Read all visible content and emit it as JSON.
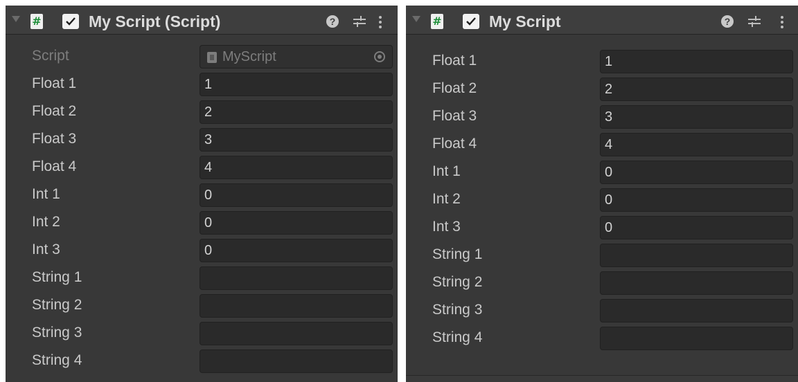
{
  "colors": {
    "panel_bg": "#383838",
    "field_bg": "#2a2a2a",
    "label_text": "#c9c9c9",
    "script_icon_green": "#1f8f3a"
  },
  "left": {
    "header": {
      "title": "My Script (Script)",
      "script_icon_glyph": "#",
      "enabled": true,
      "icons": [
        "help-icon",
        "preset-icon",
        "more-options-icon"
      ]
    },
    "script_row": {
      "label": "Script",
      "value": "MyScript"
    },
    "fields": [
      {
        "label": "Float 1",
        "value": "1"
      },
      {
        "label": "Float 2",
        "value": "2"
      },
      {
        "label": "Float 3",
        "value": "3"
      },
      {
        "label": "Float 4",
        "value": "4"
      },
      {
        "label": "Int 1",
        "value": "0"
      },
      {
        "label": "Int 2",
        "value": "0"
      },
      {
        "label": "Int 3",
        "value": "0"
      },
      {
        "label": "String 1",
        "value": ""
      },
      {
        "label": "String 2",
        "value": ""
      },
      {
        "label": "String 3",
        "value": ""
      },
      {
        "label": "String 4",
        "value": ""
      }
    ]
  },
  "right": {
    "header": {
      "title": "My Script",
      "script_icon_glyph": "#",
      "enabled": true,
      "icons": [
        "help-icon",
        "preset-icon",
        "more-options-icon"
      ]
    },
    "fields": [
      {
        "label": "Float 1",
        "value": "1"
      },
      {
        "label": "Float 2",
        "value": "2"
      },
      {
        "label": "Float 3",
        "value": "3"
      },
      {
        "label": "Float 4",
        "value": "4"
      },
      {
        "label": "Int 1",
        "value": "0"
      },
      {
        "label": "Int 2",
        "value": "0"
      },
      {
        "label": "Int 3",
        "value": "0"
      },
      {
        "label": "String 1",
        "value": ""
      },
      {
        "label": "String 2",
        "value": ""
      },
      {
        "label": "String 3",
        "value": ""
      },
      {
        "label": "String 4",
        "value": ""
      }
    ]
  }
}
